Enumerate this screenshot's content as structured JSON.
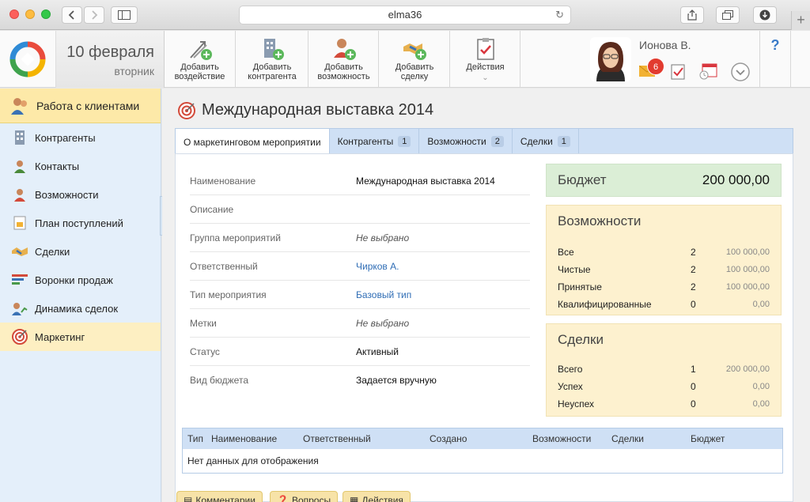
{
  "browser": {
    "url": "elma36"
  },
  "header": {
    "date": "10 февраля",
    "weekday": "вторник",
    "toolbar": [
      {
        "label1": "Добавить",
        "label2": "воздействие",
        "icon": "arrows-add-icon"
      },
      {
        "label1": "Добавить",
        "label2": "контрагента",
        "icon": "building-add-icon"
      },
      {
        "label1": "Добавить",
        "label2": "возможность",
        "icon": "person-add-icon"
      },
      {
        "label1": "Добавить",
        "label2": "сделку",
        "icon": "handshake-add-icon"
      }
    ],
    "actions_label": "Действия",
    "user_name": "Ионова В.",
    "notifications": "6",
    "help": "?"
  },
  "sidebar": {
    "section": "Работа с клиентами",
    "items": [
      {
        "label": "Контрагенты",
        "icon": "building-icon"
      },
      {
        "label": "Контакты",
        "icon": "contact-icon"
      },
      {
        "label": "Возможности",
        "icon": "opportunity-icon"
      },
      {
        "label": "План поступлений",
        "icon": "plan-icon"
      },
      {
        "label": "Сделки",
        "icon": "handshake-icon"
      },
      {
        "label": "Воронки продаж",
        "icon": "funnel-icon"
      },
      {
        "label": "Динамика сделок",
        "icon": "dynamics-icon"
      },
      {
        "label": "Маркетинг",
        "icon": "target-icon"
      }
    ]
  },
  "main": {
    "title": "Международная выставка 2014",
    "tabs": [
      {
        "label": "О маркетинговом мероприятии",
        "count": ""
      },
      {
        "label": "Контрагенты",
        "count": "1"
      },
      {
        "label": "Возможности",
        "count": "2"
      },
      {
        "label": "Сделки",
        "count": "1"
      }
    ],
    "fields": [
      {
        "label": "Наименование",
        "value": "Международная выставка 2014"
      },
      {
        "label": "Описание",
        "value": ""
      },
      {
        "label": "Группа мероприятий",
        "value": "Не выбрано"
      },
      {
        "label": "Ответственный",
        "value": "Чирков А."
      },
      {
        "label": "Тип мероприятия",
        "value": "Базовый тип"
      },
      {
        "label": "Метки",
        "value": "Не выбрано"
      },
      {
        "label": "Статус",
        "value": "Активный"
      },
      {
        "label": "Вид бюджета",
        "value": "Задается вручную"
      }
    ],
    "budget": {
      "label": "Бюджет",
      "value": "200 000,00"
    },
    "opportunities": {
      "title": "Возможности",
      "rows": [
        {
          "name": "Все",
          "count": "2",
          "sum": "100 000,00"
        },
        {
          "name": "Чистые",
          "count": "2",
          "sum": "100 000,00"
        },
        {
          "name": "Принятые",
          "count": "2",
          "sum": "100 000,00"
        },
        {
          "name": "Квалифицированные",
          "count": "0",
          "sum": "0,00"
        }
      ]
    },
    "deals": {
      "title": "Сделки",
      "rows": [
        {
          "name": "Всего",
          "count": "1",
          "sum": "200 000,00"
        },
        {
          "name": "Успех",
          "count": "0",
          "sum": "0,00"
        },
        {
          "name": "Неуспех",
          "count": "0",
          "sum": "0,00"
        }
      ]
    },
    "table": {
      "columns": [
        "Тип",
        "Наименование",
        "Ответственный",
        "Создано",
        "Возможности",
        "Сделки",
        "Бюджет"
      ],
      "empty": "Нет данных для отображения"
    },
    "bottom_buttons": [
      "Комментарии",
      "Вопросы",
      "Действия"
    ]
  }
}
